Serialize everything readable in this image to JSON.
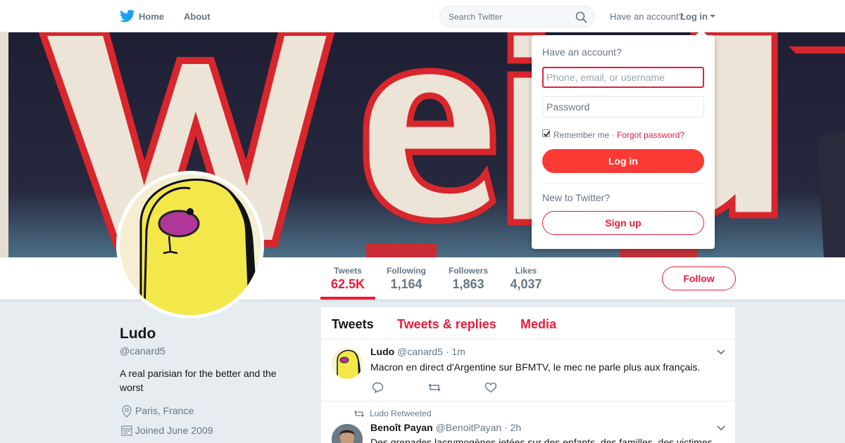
{
  "nav": {
    "home_label": "Home",
    "about_label": "About",
    "search_placeholder": "Search Twitter",
    "have_account": "Have an account?",
    "login_label": "Log in"
  },
  "banner": {
    "letters": "Weird"
  },
  "stats": [
    {
      "label": "Tweets",
      "value": "62.5K"
    },
    {
      "label": "Following",
      "value": "1,164"
    },
    {
      "label": "Followers",
      "value": "1,863"
    },
    {
      "label": "Likes",
      "value": "4,037"
    }
  ],
  "follow_label": "Follow",
  "profile": {
    "name": "Ludo",
    "handle": "@canard5",
    "bio": "A real parisian for the better and the worst",
    "location": "Paris, France",
    "joined": "Joined June 2009"
  },
  "timeline": {
    "tabs": [
      "Tweets",
      "Tweets & replies",
      "Media"
    ],
    "tweets": [
      {
        "name": "Ludo",
        "handle": "@canard5",
        "time": "· 1m",
        "text": "Macron en direct d'Argentine sur BFMTV, le mec ne parle plus aux français."
      },
      {
        "context": "Ludo Retweeted",
        "name": "Benoît Payan",
        "handle": "@BenoitPayan",
        "time": "· 2h",
        "text": "Des grenades lacrymogènes jetées sur des enfants, des familles, des victimes"
      }
    ]
  },
  "login_dropdown": {
    "title": "Have an account?",
    "username_placeholder": "Phone, email, or username",
    "password_placeholder": "Password",
    "remember_me": "Remember me ·",
    "forgot_password": "Forgot password?",
    "login_button": "Log in",
    "new_to_twitter": "New to Twitter?",
    "signup_button": "Sign up"
  },
  "colors": {
    "accent": "#e81c3c",
    "twitter_blue": "#1da1f2",
    "login_button": "#fc3a35"
  }
}
